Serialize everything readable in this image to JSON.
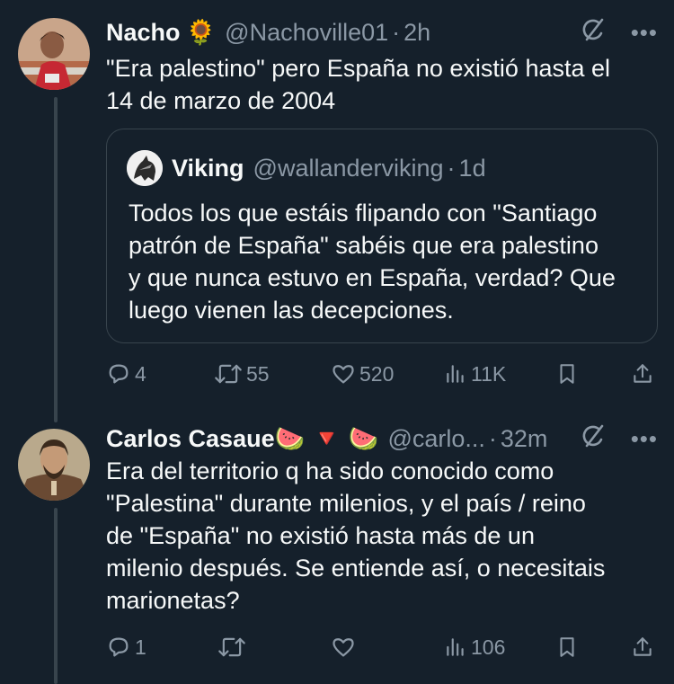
{
  "tweets": [
    {
      "name": "Nacho",
      "badge_emoji": "🌻",
      "handle": "@Nachoville01",
      "separator": "·",
      "time": "2h",
      "text": "\"Era palestino\" pero España no existió hasta el\n14 de marzo de 2004",
      "quote": {
        "name": "Viking",
        "handle": "@wallanderviking",
        "separator": "·",
        "time": "1d",
        "text": "Todos los que estáis flipando con \"Santiago\npatrón de España\" sabéis que era palestino\ny que nunca estuvo en España, verdad? Que\nluego vienen las decepciones."
      },
      "stats": {
        "replies": "4",
        "retweets": "55",
        "likes": "520",
        "views": "11K"
      }
    },
    {
      "name": "Carlos Casaue",
      "badge_emoji": "🍉 🔻 🍉",
      "handle": "@carlo...",
      "separator": "·",
      "time": "32m",
      "text": "Era del territorio q ha sido conocido como\n\"Palestina\" durante milenios, y el país / reino\nde \"España\" no existió hasta más de un\nmilenio después. Se entiende así, o necesitais\nmarionetas?",
      "stats": {
        "replies": "1",
        "retweets": "",
        "likes": "",
        "views": "106"
      }
    }
  ],
  "icons": {
    "more": "more-horizontal-icon",
    "grok": "grok-icon",
    "reply": "reply-icon",
    "retweet": "retweet-icon",
    "like": "heart-icon",
    "views": "views-icon",
    "bookmark": "bookmark-icon",
    "share": "share-icon"
  },
  "colors": {
    "background": "#15202b",
    "text": "#f7f9f9",
    "secondary": "#8b98a5",
    "border": "#38444d"
  }
}
